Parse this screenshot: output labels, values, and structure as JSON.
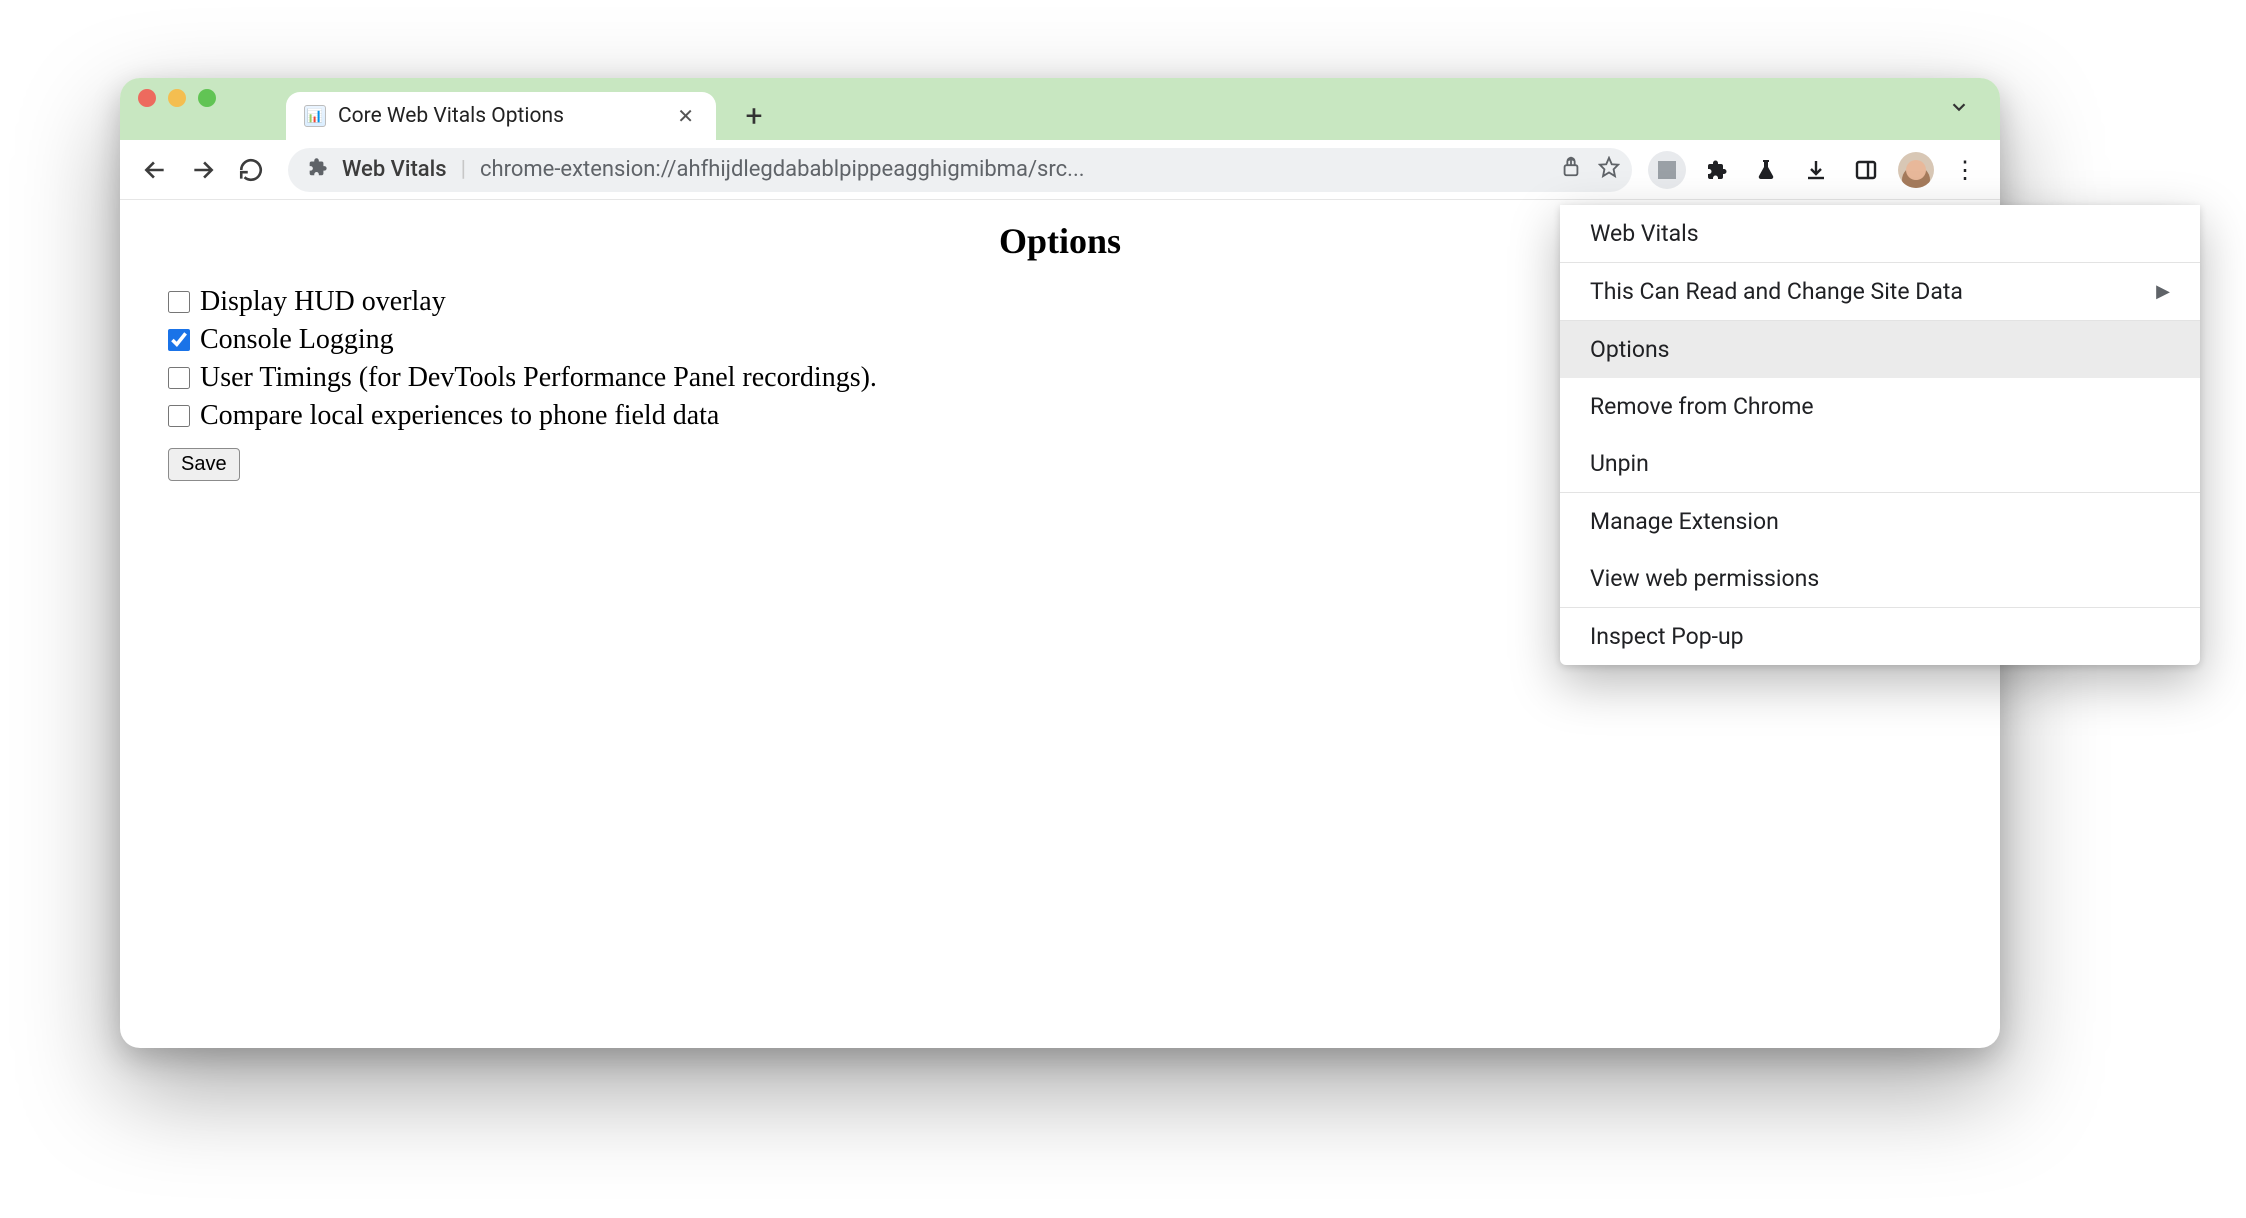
{
  "tab": {
    "title": "Core Web Vitals Options"
  },
  "omnibox": {
    "site_name": "Web Vitals",
    "url": "chrome-extension://ahfhijdlegdabablpippeagghigmibma/src..."
  },
  "page": {
    "heading": "Options",
    "options": [
      {
        "label": "Display HUD overlay",
        "checked": false
      },
      {
        "label": "Console Logging",
        "checked": true
      },
      {
        "label": "User Timings (for DevTools Performance Panel recordings).",
        "checked": false
      },
      {
        "label": "Compare local experiences to phone field data",
        "checked": false
      }
    ],
    "save_label": "Save"
  },
  "context_menu": {
    "header": "Web Vitals",
    "items": [
      {
        "label": "This Can Read and Change Site Data",
        "submenu": true,
        "highlight": false
      },
      {
        "label": "Options",
        "submenu": false,
        "highlight": true
      },
      {
        "label": "Remove from Chrome",
        "submenu": false,
        "highlight": false
      },
      {
        "label": "Unpin",
        "submenu": false,
        "highlight": false
      },
      {
        "label": "Manage Extension",
        "submenu": false,
        "highlight": false
      },
      {
        "label": "View web permissions",
        "submenu": false,
        "highlight": false
      },
      {
        "label": "Inspect Pop-up",
        "submenu": false,
        "highlight": false
      }
    ]
  }
}
